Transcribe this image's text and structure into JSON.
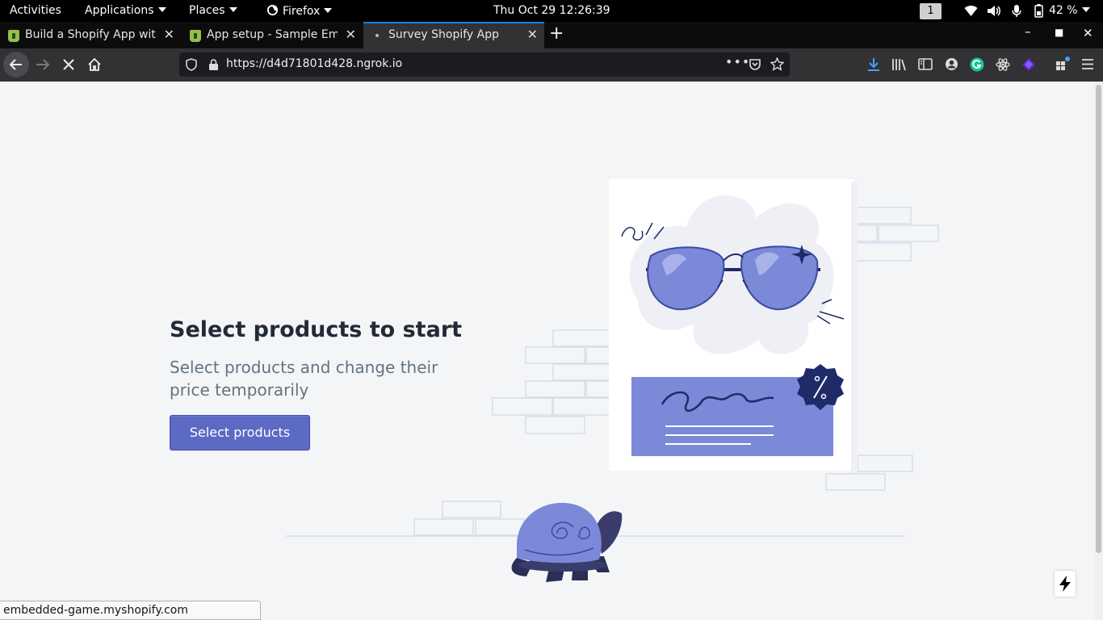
{
  "topbar": {
    "activities": "Activities",
    "applications": "Applications",
    "places": "Places",
    "firefox": "Firefox",
    "clock": "Thu Oct 29  12:26:39",
    "workspace": "1",
    "battery": "42 %"
  },
  "tabs": [
    {
      "title": "Build a Shopify App with N",
      "active": false
    },
    {
      "title": "App setup - Sample Emb",
      "active": false
    },
    {
      "title": "Survey Shopify App",
      "active": true
    }
  ],
  "navbar": {
    "url": "https://d4d71801d428.ngrok.io"
  },
  "main": {
    "heading": "Select products to start",
    "subtext": "Select products and change their price temporarily",
    "button_label": "Select products"
  },
  "statusbar": {
    "text": "embedded-game.myshopify.com"
  },
  "colors": {
    "accent": "#5c6ac4",
    "illustration_primary": "#7b89d8",
    "illustration_dark": "#1f2a68",
    "tab_indicator": "#0a84ff"
  }
}
